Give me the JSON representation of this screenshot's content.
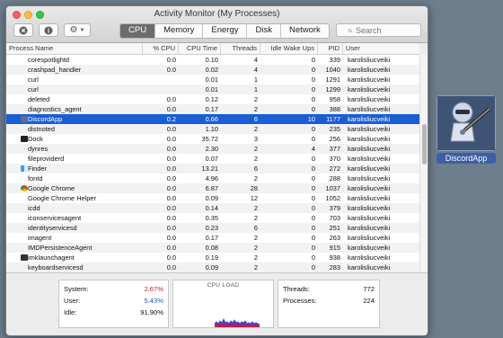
{
  "window": {
    "title": "Activity Monitor (My Processes)"
  },
  "toolbar": {
    "tabs": [
      "CPU",
      "Memory",
      "Energy",
      "Disk",
      "Network"
    ],
    "active_tab": "CPU",
    "search_placeholder": "Search"
  },
  "columns": [
    "Process Name",
    "% CPU",
    "CPU Time",
    "Threads",
    "Idle Wake Ups",
    "PID",
    "User"
  ],
  "processes": [
    {
      "name": "corespotlightd",
      "cpu": "0.0",
      "time": "0.10",
      "threads": "4",
      "wake": "0",
      "pid": "339",
      "user": "karolisliucveiki"
    },
    {
      "name": "crashpad_handler",
      "cpu": "0.0",
      "time": "0.02",
      "threads": "4",
      "wake": "0",
      "pid": "1040",
      "user": "karolisliucveiki"
    },
    {
      "name": "curl",
      "cpu": "",
      "time": "0.01",
      "threads": "1",
      "wake": "0",
      "pid": "1291",
      "user": "karolisliucveiki"
    },
    {
      "name": "curl",
      "cpu": "",
      "time": "0.01",
      "threads": "1",
      "wake": "0",
      "pid": "1299",
      "user": "karolisliucveiki"
    },
    {
      "name": "deleted",
      "cpu": "0.0",
      "time": "0.12",
      "threads": "2",
      "wake": "0",
      "pid": "958",
      "user": "karolisliucveiki"
    },
    {
      "name": "diagnostics_agent",
      "cpu": "0.0",
      "time": "0.17",
      "threads": "2",
      "wake": "0",
      "pid": "388",
      "user": "karolisliucveiki"
    },
    {
      "name": "DiscordApp",
      "cpu": "0.2",
      "time": "0.66",
      "threads": "6",
      "wake": "10",
      "pid": "1177",
      "user": "karolisliucveiki",
      "selected": true,
      "icon": "discordapp-icon"
    },
    {
      "name": "distnoted",
      "cpu": "0.0",
      "time": "1.10",
      "threads": "2",
      "wake": "0",
      "pid": "235",
      "user": "karolisliucveiki"
    },
    {
      "name": "Dock",
      "cpu": "0.0",
      "time": "35.72",
      "threads": "3",
      "wake": "0",
      "pid": "256",
      "user": "karolisliucveiki",
      "icon": "dock-icon"
    },
    {
      "name": "dynres",
      "cpu": "0.0",
      "time": "2.30",
      "threads": "2",
      "wake": "4",
      "pid": "377",
      "user": "karolisliucveiki"
    },
    {
      "name": "fileproviderd",
      "cpu": "0.0",
      "time": "0.07",
      "threads": "2",
      "wake": "0",
      "pid": "370",
      "user": "karolisliucveiki"
    },
    {
      "name": "Finder",
      "cpu": "0.0",
      "time": "13.21",
      "threads": "6",
      "wake": "0",
      "pid": "272",
      "user": "karolisliucveiki",
      "icon": "finder-icon"
    },
    {
      "name": "fontd",
      "cpu": "0.0",
      "time": "4.96",
      "threads": "2",
      "wake": "0",
      "pid": "288",
      "user": "karolisliucveiki"
    },
    {
      "name": "Google Chrome",
      "cpu": "0.0",
      "time": "6.87",
      "threads": "28",
      "wake": "0",
      "pid": "1037",
      "user": "karolisliucveiki",
      "icon": "chrome-icon"
    },
    {
      "name": "Google Chrome Helper",
      "cpu": "0.0",
      "time": "0.09",
      "threads": "12",
      "wake": "0",
      "pid": "1052",
      "user": "karolisliucveiki"
    },
    {
      "name": "icdd",
      "cpu": "0.0",
      "time": "0.14",
      "threads": "2",
      "wake": "0",
      "pid": "379",
      "user": "karolisliucveiki"
    },
    {
      "name": "iconservicesagent",
      "cpu": "0.0",
      "time": "0.35",
      "threads": "2",
      "wake": "0",
      "pid": "703",
      "user": "karolisliucveiki"
    },
    {
      "name": "identityservicesd",
      "cpu": "0.0",
      "time": "0.23",
      "threads": "6",
      "wake": "0",
      "pid": "251",
      "user": "karolisliucveiki"
    },
    {
      "name": "imagent",
      "cpu": "0.0",
      "time": "0.17",
      "threads": "2",
      "wake": "0",
      "pid": "263",
      "user": "karolisliucveiki"
    },
    {
      "name": "IMDPersistenceAgent",
      "cpu": "0.0",
      "time": "0.08",
      "threads": "2",
      "wake": "0",
      "pid": "915",
      "user": "karolisliucveiki"
    },
    {
      "name": "imklaunchagent",
      "cpu": "0.0",
      "time": "0.19",
      "threads": "2",
      "wake": "0",
      "pid": "938",
      "user": "karolisliucveiki",
      "icon": "imklaunchagent-icon"
    },
    {
      "name": "keyboardservicesd",
      "cpu": "0.0",
      "time": "0.09",
      "threads": "2",
      "wake": "0",
      "pid": "283",
      "user": "karolisliucveiki"
    }
  ],
  "stats": {
    "system_label": "System:",
    "system_value": "2.67%",
    "user_label": "User:",
    "user_value": "5.43%",
    "idle_label": "Idle:",
    "idle_value": "91.90%",
    "cpu_load_title": "CPU LOAD",
    "threads_label": "Threads:",
    "threads_value": "772",
    "processes_label": "Processes:",
    "processes_value": "224"
  },
  "colors": {
    "system": "#d0202a",
    "user": "#2456c6",
    "selection": "#1a5ed6"
  },
  "dock_app": {
    "label": "DiscordApp"
  }
}
